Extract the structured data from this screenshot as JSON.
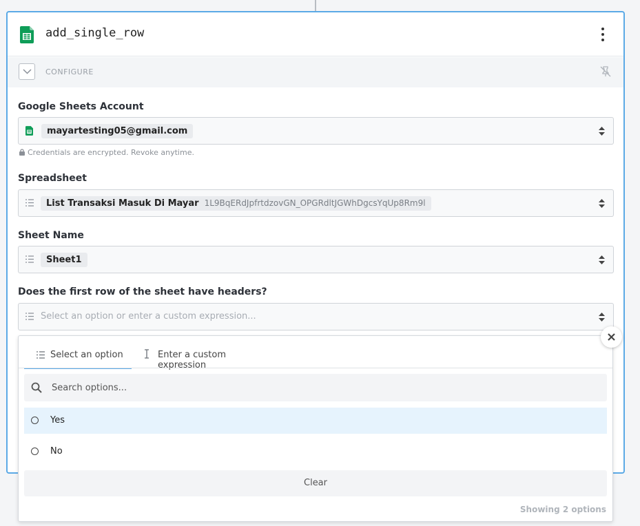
{
  "step": {
    "title": "add_single_row",
    "configure_label": "CONFIGURE"
  },
  "fields": {
    "account": {
      "label": "Google Sheets Account",
      "value": "mayartesting05@gmail.com",
      "hint": "Credentials are encrypted. Revoke anytime."
    },
    "spreadsheet": {
      "label": "Spreadsheet",
      "value": "List Transaksi Masuk Di Mayar",
      "id": "1L9BqERdJpfrtdzovGN_OPGRdltJGWhDgcsYqUp8Rm9l"
    },
    "sheet_name": {
      "label": "Sheet Name",
      "value": "Sheet1"
    },
    "headers": {
      "label": "Does the first row of the sheet have headers?",
      "placeholder": "Select an option or enter a custom expression..."
    }
  },
  "dropdown": {
    "tabs": [
      {
        "label": "Select an option",
        "active": true
      },
      {
        "label": "Enter a custom expression",
        "active": false
      }
    ],
    "search_placeholder": "Search options...",
    "options": [
      {
        "label": "Yes",
        "highlighted": true
      },
      {
        "label": "No",
        "highlighted": false
      }
    ],
    "clear_label": "Clear",
    "footer": "Showing 2 options"
  },
  "colors": {
    "accent": "#5aa9e6",
    "sheets_green": "#0f9d58",
    "highlight": "#e6f3fd"
  },
  "icons": [
    "google-sheets-icon",
    "kebab-menu-icon",
    "chevron-down-icon",
    "unpin-icon",
    "lock-icon",
    "list-icon",
    "sort-updown-icon",
    "text-cursor-icon",
    "search-icon",
    "radio-icon",
    "close-icon"
  ]
}
